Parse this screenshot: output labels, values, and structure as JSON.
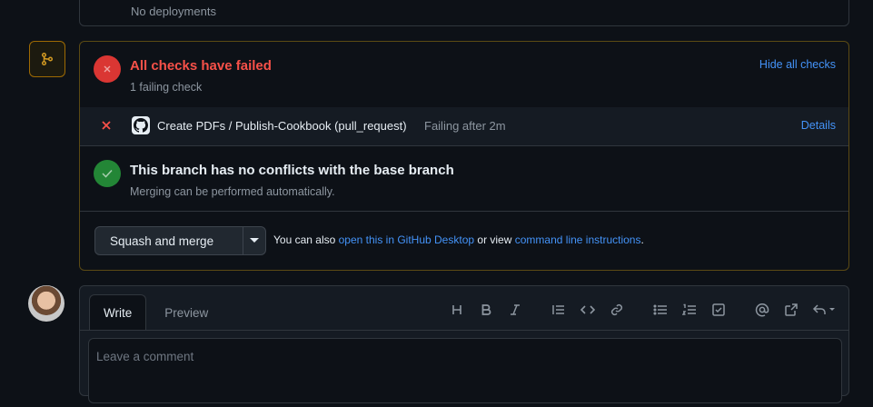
{
  "deployments": {
    "text": "No deployments"
  },
  "checks": {
    "title": "All checks have failed",
    "subtitle": "1 failing check",
    "hide_link": "Hide all checks",
    "items": [
      {
        "name": "Create PDFs / Publish-Cookbook (pull_request)",
        "status": "Failing after 2m",
        "details": "Details"
      }
    ]
  },
  "conflicts": {
    "title": "This branch has no conflicts with the base branch",
    "subtitle": "Merging can be performed automatically."
  },
  "merge": {
    "button_label": "Squash and merge",
    "also_prefix": "You can also",
    "desktop_link": "open this in GitHub Desktop",
    "also_middle": "or view",
    "cli_link": "command line instructions",
    "also_suffix": "."
  },
  "comment": {
    "tabs": [
      {
        "label": "Write"
      },
      {
        "label": "Preview"
      }
    ],
    "placeholder": "Leave a comment",
    "toolbar": [
      "heading-icon",
      "bold-icon",
      "italic-icon",
      "quote-icon",
      "code-icon",
      "link-icon",
      "unordered-list-icon",
      "ordered-list-icon",
      "task-list-icon",
      "mention-icon",
      "reference-icon",
      "reply-icon"
    ]
  },
  "colors": {
    "fail": "#da3633",
    "success": "#238636",
    "link": "#4493f8",
    "warning_border": "#9e6a03"
  }
}
